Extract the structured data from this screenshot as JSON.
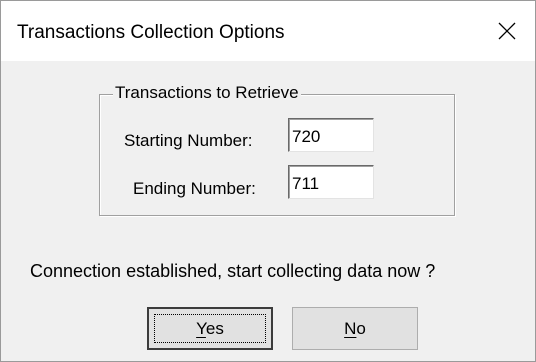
{
  "window": {
    "title": "Transactions Collection Options",
    "close_icon": "close-icon"
  },
  "group": {
    "legend": "Transactions to Retrieve",
    "starting_label": "Starting Number:",
    "starting_value": "720",
    "ending_label": "Ending Number:",
    "ending_value": "711"
  },
  "prompt": "Connection established, start collecting data now ?",
  "buttons": {
    "yes_mnemonic": "Y",
    "yes_rest": "es",
    "no_mnemonic": "N",
    "no_rest": "o"
  },
  "colors": {
    "dialog_bg": "#f0f0f0",
    "titlebar_bg": "#ffffff",
    "button_bg": "#e1e1e1"
  }
}
